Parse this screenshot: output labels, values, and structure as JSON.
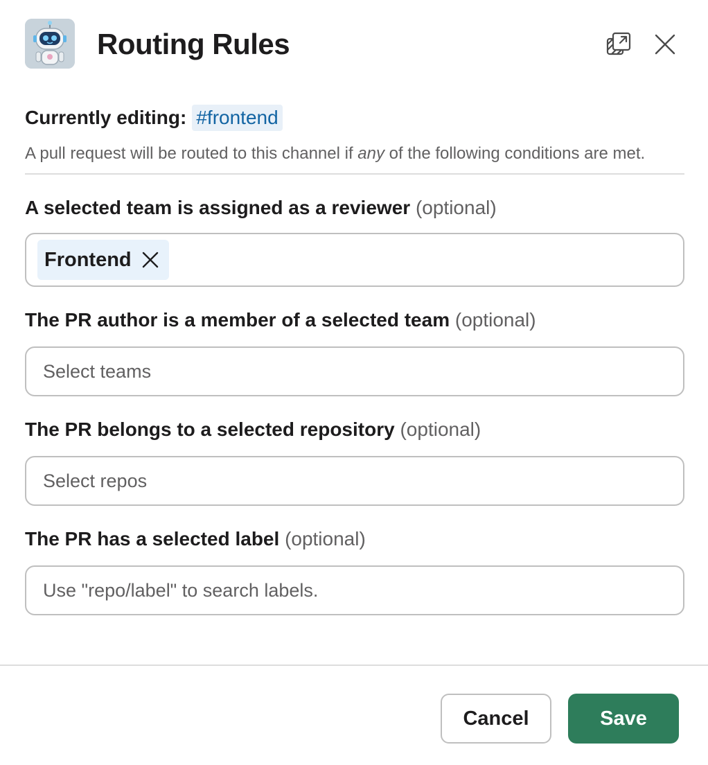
{
  "header": {
    "title": "Routing Rules",
    "popout_icon": "popout-icon",
    "close_icon": "close-icon"
  },
  "editing": {
    "label": "Currently editing:",
    "channel": "#frontend"
  },
  "description": {
    "before": "A pull request will be routed to this channel if ",
    "emphasis": "any",
    "after": " of the following conditions are met."
  },
  "fields": {
    "reviewer_team": {
      "label": "A selected team is assigned as a reviewer",
      "optional": "(optional)",
      "selected": [
        "Frontend"
      ]
    },
    "author_team": {
      "label": "The PR author is a member of a selected team",
      "optional": "(optional)",
      "placeholder": "Select teams"
    },
    "repository": {
      "label": "The PR belongs to a selected repository",
      "optional": "(optional)",
      "placeholder": "Select repos"
    },
    "label": {
      "label": "The PR has a selected label",
      "optional": "(optional)",
      "placeholder": "Use \"repo/label\" to search labels."
    }
  },
  "footer": {
    "cancel_label": "Cancel",
    "save_label": "Save"
  },
  "colors": {
    "accent": "#2e7d5b",
    "channel_link": "#1264a3",
    "channel_bg": "#e8f0f8"
  }
}
